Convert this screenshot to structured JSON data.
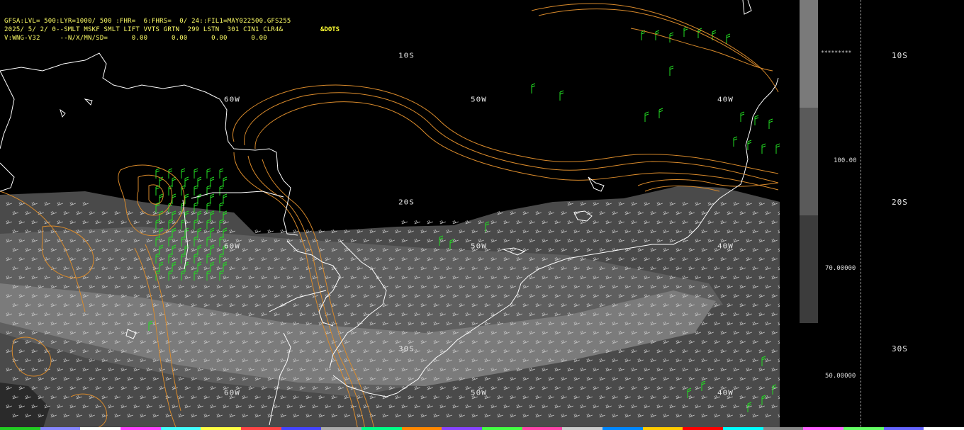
{
  "header": {
    "line1": "GFSA:LVL= 500:LYR=1000/ 500 :FHR=  6:FHRS=  0/ 24::FIL1=MAY022500.GFS255",
    "line2": "2025/ 5/ 2/ 0--SMLT MSKF SMLT LIFT VVTS GRTN  299 LSTN  301 CIN1 CLR4&",
    "line3": "V:WNG-V32     --N/X/MN/SD=      0.00      0.00      0.00      0.00",
    "dots_label": "&DOTS"
  },
  "map_labels": {
    "lat_10s": "10S",
    "lat_20s": "20S",
    "lat_30s": "30S",
    "lon_60w_top": "60W",
    "lon_50w_top": "50W",
    "lon_40w_top": "40W",
    "lon_60w_mid": "60W",
    "lon_50w_mid": "50W",
    "lon_40w_mid": "40W",
    "lon_60w_bot": "60W",
    "lon_50w_bot": "50W",
    "lon_40w_bot": "40W"
  },
  "colorbar": {
    "stars": "*********",
    "labels": [
      "100.00",
      "70.00000",
      "50.00000"
    ],
    "colors": [
      "#7a7a7a",
      "#5a5a5a",
      "#3c3c3c"
    ]
  },
  "side_lat_labels": [
    "10S",
    "20S",
    "30S"
  ],
  "colors": {
    "contour": "#d98a2b",
    "coast": "#ffffff",
    "wind_barb_green": "#22dd22",
    "wind_barb_gray": "#bdbdbd",
    "cloud_shade_1": "#4a4a4a",
    "cloud_shade_2": "#6a6a6a",
    "cloud_shade_3": "#8a8a8a",
    "header_text": "#ffff66"
  },
  "bottom_strip_colors": [
    "#22cc22",
    "#8888ff",
    "#ffffff",
    "#ff44ff",
    "#44ffff",
    "#ffff44",
    "#ff4444",
    "#4444ff",
    "#aaaaaa",
    "#00ff88",
    "#ff8800",
    "#8844ff",
    "#44ff44",
    "#ff44aa",
    "#cccccc",
    "#0088ff",
    "#ffcc00",
    "#ff0000",
    "#00ffff",
    "#888888",
    "#ff66ff",
    "#66ff66",
    "#6666ff",
    "#ffffff"
  ]
}
